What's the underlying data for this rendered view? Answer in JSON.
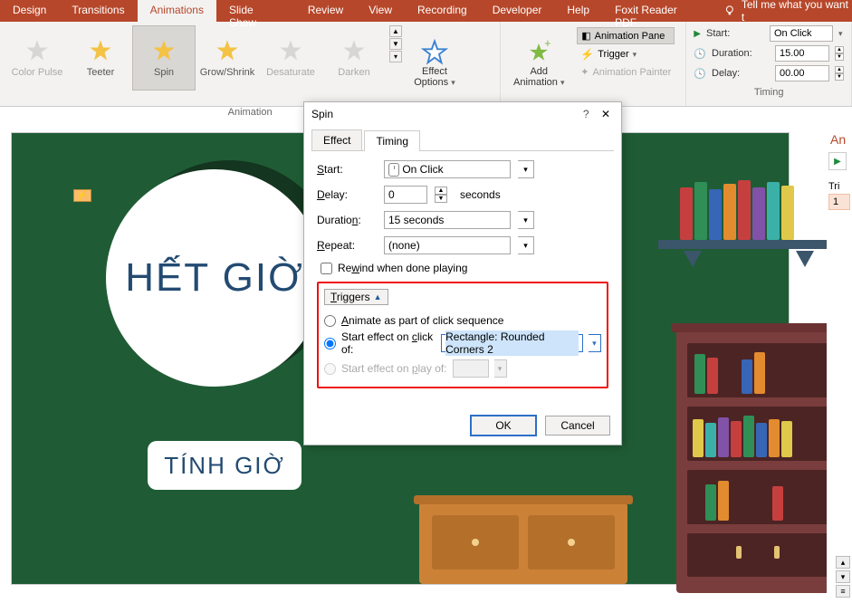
{
  "tabs": {
    "design": "Design",
    "transitions": "Transitions",
    "animations": "Animations",
    "slideshow": "Slide Show",
    "review": "Review",
    "view": "View",
    "recording": "Recording",
    "developer": "Developer",
    "help": "Help",
    "foxit": "Foxit Reader PDF",
    "tell_me": "Tell me what you want t"
  },
  "ribbon": {
    "anim": {
      "color_pulse": "Color Pulse",
      "teeter": "Teeter",
      "spin": "Spin",
      "grow_shrink": "Grow/Shrink",
      "desaturate": "Desaturate",
      "darken": "Darken",
      "group_label": "Animation"
    },
    "effect_options": "Effect\nOptions",
    "add_animation": "Add\nAnimation",
    "adv": {
      "pane": "Animation Pane",
      "trigger": "Trigger",
      "painter": "Animation Painter",
      "group_label_fragment": "ation"
    },
    "timing": {
      "start_label": "Start:",
      "start_value": "On Click",
      "duration_label": "Duration:",
      "duration_value": "15.00",
      "delay_label": "Delay:",
      "delay_value": "00.00",
      "group_label": "Timing"
    }
  },
  "dialog": {
    "title": "Spin",
    "tab_effect": "Effect",
    "tab_timing": "Timing",
    "start_label": "Start:",
    "start_value": "On Click",
    "delay_label": "Delay:",
    "delay_value": "0",
    "delay_unit": "seconds",
    "duration_label": "Duration:",
    "duration_value": "15 seconds",
    "repeat_label": "Repeat:",
    "repeat_value": "(none)",
    "rewind_label": "Rewind when done playing",
    "triggers_label": "Triggers",
    "opt_sequence": "Animate as part of click sequence",
    "opt_click_of": "Start effect on click of:",
    "click_of_value": "Rectangle: Rounded Corners 2",
    "opt_play_of": "Start effect on play of:",
    "ok": "OK",
    "cancel": "Cancel"
  },
  "slide": {
    "het_gio": "HẾT GIỜ",
    "tinh_gio": "TÍNH GIỜ",
    "badge_glyph": "⚡"
  },
  "right_panel": {
    "title": "An",
    "tri_label": "Tri",
    "item_num": "1"
  }
}
